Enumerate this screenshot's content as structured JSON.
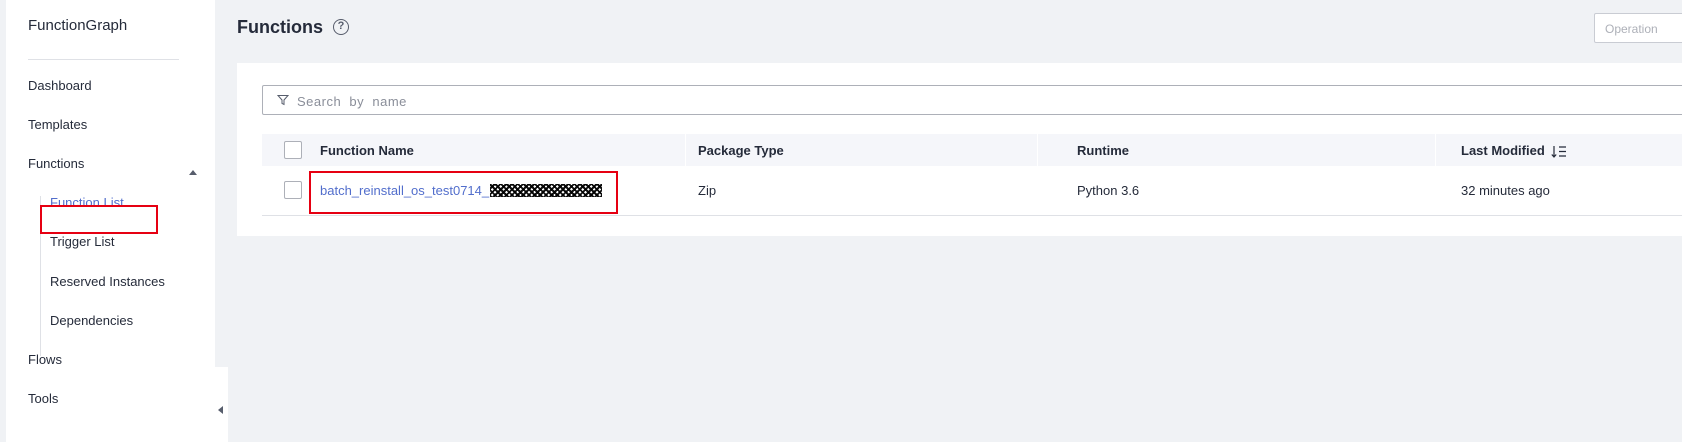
{
  "sidebar": {
    "title": "FunctionGraph",
    "items": [
      {
        "label": "Dashboard"
      },
      {
        "label": "Templates"
      },
      {
        "label": "Functions"
      },
      {
        "label": "Flows"
      },
      {
        "label": "Tools"
      }
    ],
    "sub_items": [
      {
        "label": "Function List"
      },
      {
        "label": "Trigger List"
      },
      {
        "label": "Reserved Instances"
      },
      {
        "label": "Dependencies"
      }
    ],
    "active": "Function List"
  },
  "header": {
    "title": "Functions",
    "help_icon": "question-circle-icon",
    "operation_button": "Operation"
  },
  "search": {
    "placeholder": "Search  by  name",
    "value": ""
  },
  "table": {
    "columns": [
      "Function Name",
      "Package Type",
      "Runtime",
      "Last Modified"
    ],
    "rows": [
      {
        "name": "batch_reinstall_os_test0714_",
        "package_type": "Zip",
        "runtime": "Python 3.6",
        "last_modified": "32 minutes ago"
      }
    ]
  },
  "colors": {
    "accent": "#526ecc",
    "highlight": "#e60012",
    "background": "#f0f2f5"
  }
}
